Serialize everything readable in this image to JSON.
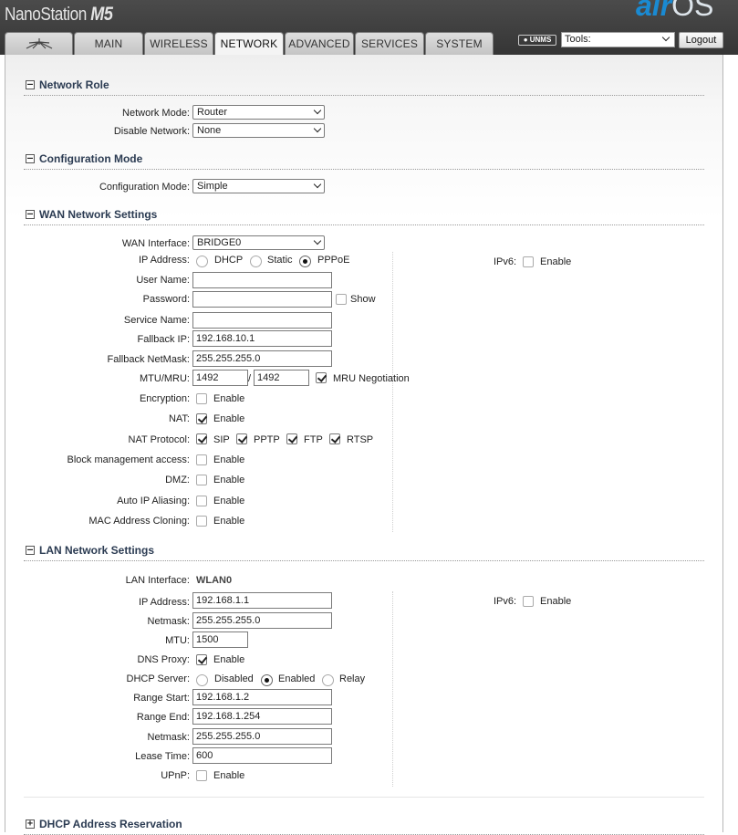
{
  "header": {
    "brand_name": "NanoStation",
    "brand_model": "M5",
    "logo_air": "air",
    "logo_os": "OS"
  },
  "tabs": [
    {
      "label": "MAIN"
    },
    {
      "label": "WIRELESS"
    },
    {
      "label": "NETWORK"
    },
    {
      "label": "ADVANCED"
    },
    {
      "label": "SERVICES"
    },
    {
      "label": "SYSTEM"
    }
  ],
  "active_tab": "NETWORK",
  "toolbar": {
    "unms_label": "UNMS",
    "tools_label": "Tools:",
    "logout_label": "Logout"
  },
  "network_role": {
    "title": "Network Role",
    "network_mode_label": "Network Mode:",
    "network_mode_value": "Router",
    "disable_network_label": "Disable Network:",
    "disable_network_value": "None"
  },
  "configuration_mode": {
    "title": "Configuration Mode",
    "label": "Configuration Mode:",
    "value": "Simple"
  },
  "wan": {
    "title": "WAN Network Settings",
    "interface_label": "WAN Interface:",
    "interface_value": "BRIDGE0",
    "ip_address_label": "IP Address:",
    "ip_modes": [
      "DHCP",
      "Static",
      "PPPoE"
    ],
    "ip_mode_selected": "PPPoE",
    "user_name_label": "User Name:",
    "user_name_value": "",
    "password_label": "Password:",
    "password_value": "",
    "show_label": "Show",
    "service_name_label": "Service Name:",
    "service_name_value": "",
    "fallback_ip_label": "Fallback IP:",
    "fallback_ip_value": "192.168.10.1",
    "fallback_netmask_label": "Fallback NetMask:",
    "fallback_netmask_value": "255.255.255.0",
    "mtu_mru_label": "MTU/MRU:",
    "mtu_value": "1492",
    "mru_separator": "/",
    "mru_value": "1492",
    "mru_negotiation_label": "MRU Negotiation",
    "mru_negotiation_checked": true,
    "encryption_label": "Encryption:",
    "encryption_checked": false,
    "nat_label": "NAT:",
    "nat_checked": true,
    "nat_protocol_label": "NAT Protocol:",
    "nat_protocols": [
      {
        "label": "SIP",
        "checked": true
      },
      {
        "label": "PPTP",
        "checked": true
      },
      {
        "label": "FTP",
        "checked": true
      },
      {
        "label": "RTSP",
        "checked": true
      }
    ],
    "block_mgmt_label": "Block management access:",
    "block_mgmt_checked": false,
    "dmz_label": "DMZ:",
    "dmz_checked": false,
    "auto_ip_label": "Auto IP Aliasing:",
    "auto_ip_checked": false,
    "mac_clone_label": "MAC Address Cloning:",
    "mac_clone_checked": false,
    "ipv6_label": "IPv6:",
    "ipv6_checked": false,
    "enable_label": "Enable"
  },
  "lan": {
    "title": "LAN Network Settings",
    "interface_label": "LAN Interface:",
    "interface_value": "WLAN0",
    "ip_address_label": "IP Address:",
    "ip_address_value": "192.168.1.1",
    "netmask_label": "Netmask:",
    "netmask_value": "255.255.255.0",
    "mtu_label": "MTU:",
    "mtu_value": "1500",
    "dns_proxy_label": "DNS Proxy:",
    "dns_proxy_checked": true,
    "dhcp_server_label": "DHCP Server:",
    "dhcp_modes": [
      "Disabled",
      "Enabled",
      "Relay"
    ],
    "dhcp_mode_selected": "Enabled",
    "range_start_label": "Range Start:",
    "range_start_value": "192.168.1.2",
    "range_end_label": "Range End:",
    "range_end_value": "192.168.1.254",
    "dhcp_netmask_label": "Netmask:",
    "dhcp_netmask_value": "255.255.255.0",
    "lease_time_label": "Lease Time:",
    "lease_time_value": "600",
    "upnp_label": "UPnP:",
    "upnp_checked": false,
    "ipv6_label": "IPv6:",
    "ipv6_checked": false,
    "enable_label": "Enable"
  },
  "dhcp_reservation": {
    "title": "DHCP Address Reservation"
  }
}
